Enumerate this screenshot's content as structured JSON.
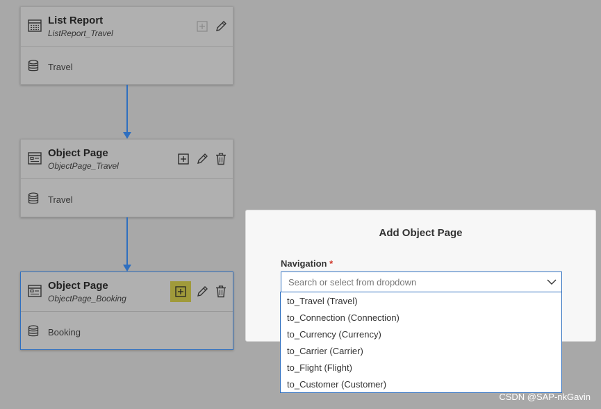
{
  "flow": {
    "cards": [
      {
        "title": "List Report",
        "subtitle": "ListReport_Travel",
        "entity": "Travel",
        "icon": "list-report-icon",
        "actions": [
          "add-icon",
          "edit-icon"
        ]
      },
      {
        "title": "Object Page",
        "subtitle": "ObjectPage_Travel",
        "entity": "Travel",
        "icon": "object-page-icon",
        "actions": [
          "add-icon",
          "edit-icon",
          "delete-icon"
        ]
      },
      {
        "title": "Object Page",
        "subtitle": "ObjectPage_Booking",
        "entity": "Booking",
        "icon": "object-page-icon",
        "actions": [
          "add-icon",
          "edit-icon",
          "delete-icon"
        ],
        "selected": true
      }
    ]
  },
  "dialog": {
    "title": "Add Object Page",
    "navigation_label": "Navigation",
    "required_marker": "*",
    "placeholder": "Search or select from dropdown",
    "options": [
      "to_Travel (Travel)",
      "to_Connection (Connection)",
      "to_Currency (Currency)",
      "to_Carrier (Carrier)",
      "to_Flight (Flight)",
      "to_Customer (Customer)"
    ]
  },
  "watermark": "CSDN @SAP-nkGavin",
  "colors": {
    "accent": "#2f6fbf",
    "highlight": "#a09a3a",
    "required": "#d0382b"
  }
}
